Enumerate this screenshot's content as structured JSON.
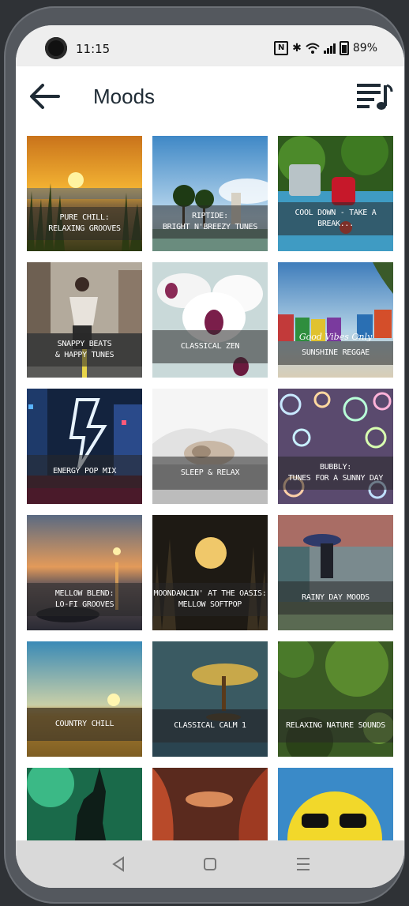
{
  "status_bar": {
    "time": "11:15",
    "battery": "89%"
  },
  "header": {
    "title": "Moods"
  },
  "tiles": [
    {
      "label": "PURE CHILL:\nRELAXING GROOVES"
    },
    {
      "label": "RIPTIDE:\nBRIGHT N'BREEZY TUNES"
    },
    {
      "label": "COOL DOWN - TAKE A BREAK..."
    },
    {
      "label": "SNAPPY BEATS\n& HAPPY TUNES"
    },
    {
      "label": "CLASSICAL ZEN"
    },
    {
      "label": "SUNSHINE REGGAE",
      "script": "Good Vibes Only"
    },
    {
      "label": "ENERGY POP MIX"
    },
    {
      "label": "SLEEP & RELAX"
    },
    {
      "label": "BUBBLY:\nTUNES FOR A SUNNY DAY"
    },
    {
      "label": "MELLOW BLEND:\nLO-FI GROOVES"
    },
    {
      "label": "MOONDANCIN' AT THE OASIS:\nMELLOW SOFTPOP"
    },
    {
      "label": "RAINY DAY MOODS"
    },
    {
      "label": "COUNTRY CHILL"
    },
    {
      "label": "CLASSICAL CALM 1"
    },
    {
      "label": "RELAXING NATURE SOUNDS"
    },
    {
      "label": ""
    },
    {
      "label": ""
    },
    {
      "label": ""
    }
  ],
  "colors": {
    "accent": "#f06418",
    "title": "#1f2b35"
  }
}
